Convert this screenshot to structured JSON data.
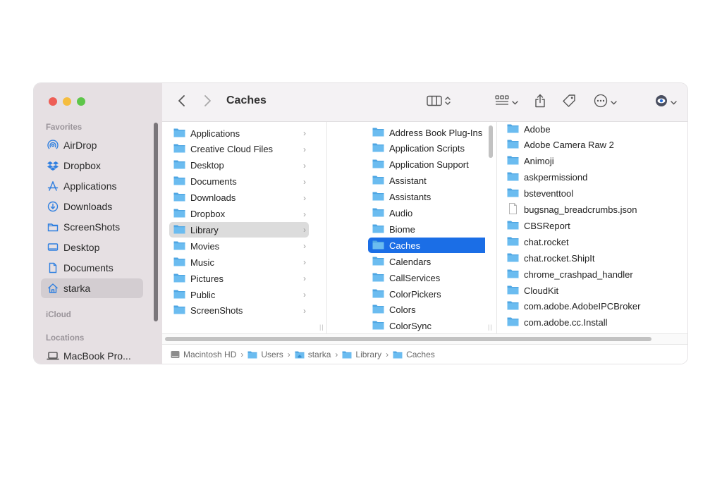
{
  "window": {
    "title": "Caches"
  },
  "sidebar": {
    "sections": [
      {
        "label": "Favorites"
      },
      {
        "label": "iCloud"
      },
      {
        "label": "Locations"
      }
    ],
    "favorites": [
      {
        "label": "AirDrop",
        "icon": "airdrop-icon"
      },
      {
        "label": "Dropbox",
        "icon": "dropbox-icon"
      },
      {
        "label": "Applications",
        "icon": "applications-icon"
      },
      {
        "label": "Downloads",
        "icon": "downloads-icon"
      },
      {
        "label": "ScreenShots",
        "icon": "folder-icon"
      },
      {
        "label": "Desktop",
        "icon": "desktop-icon"
      },
      {
        "label": "Documents",
        "icon": "document-icon"
      },
      {
        "label": "starka",
        "icon": "home-icon",
        "selected": true
      }
    ],
    "locations": [
      {
        "label": "MacBook Pro...",
        "icon": "laptop-icon"
      }
    ]
  },
  "columns": [
    {
      "items": [
        {
          "label": "Applications"
        },
        {
          "label": "Creative Cloud Files"
        },
        {
          "label": "Desktop"
        },
        {
          "label": "Documents"
        },
        {
          "label": "Downloads"
        },
        {
          "label": "Dropbox"
        },
        {
          "label": "Library",
          "selected": "gray"
        },
        {
          "label": "Movies"
        },
        {
          "label": "Music"
        },
        {
          "label": "Pictures"
        },
        {
          "label": "Public"
        },
        {
          "label": "ScreenShots"
        }
      ]
    },
    {
      "items": [
        {
          "label": "Address Book Plug-Ins"
        },
        {
          "label": "Application Scripts"
        },
        {
          "label": "Application Support"
        },
        {
          "label": "Assistant"
        },
        {
          "label": "Assistants"
        },
        {
          "label": "Audio"
        },
        {
          "label": "Biome"
        },
        {
          "label": "Caches",
          "selected": "blue"
        },
        {
          "label": "Calendars"
        },
        {
          "label": "CallServices"
        },
        {
          "label": "ColorPickers"
        },
        {
          "label": "Colors"
        },
        {
          "label": "ColorSync"
        }
      ]
    },
    {
      "items": [
        {
          "label": "Adobe",
          "kind": "folder"
        },
        {
          "label": "Adobe Camera Raw 2",
          "kind": "folder"
        },
        {
          "label": "Animoji",
          "kind": "folder"
        },
        {
          "label": "askpermissiond",
          "kind": "folder"
        },
        {
          "label": "bsteventtool",
          "kind": "folder"
        },
        {
          "label": "bugsnag_breadcrumbs.json",
          "kind": "file"
        },
        {
          "label": "CBSReport",
          "kind": "folder"
        },
        {
          "label": "chat.rocket",
          "kind": "folder"
        },
        {
          "label": "chat.rocket.ShipIt",
          "kind": "folder"
        },
        {
          "label": "chrome_crashpad_handler",
          "kind": "folder"
        },
        {
          "label": "CloudKit",
          "kind": "folder"
        },
        {
          "label": "com.adobe.AdobeIPCBroker",
          "kind": "folder"
        },
        {
          "label": "com.adobe.cc.Install",
          "kind": "folder"
        }
      ]
    }
  ],
  "pathbar": [
    {
      "label": "Macintosh HD",
      "icon": "hard-drive-icon"
    },
    {
      "label": "Users",
      "icon": "folder-icon"
    },
    {
      "label": "starka",
      "icon": "home-folder-icon"
    },
    {
      "label": "Library",
      "icon": "folder-icon"
    },
    {
      "label": "Caches",
      "icon": "folder-icon"
    }
  ],
  "colors": {
    "accent": "#1b6ee6",
    "folder": "#5fb6ec",
    "sidebar_bg": "#e6e0e3",
    "sidebar_icon": "#2f7fe0"
  }
}
